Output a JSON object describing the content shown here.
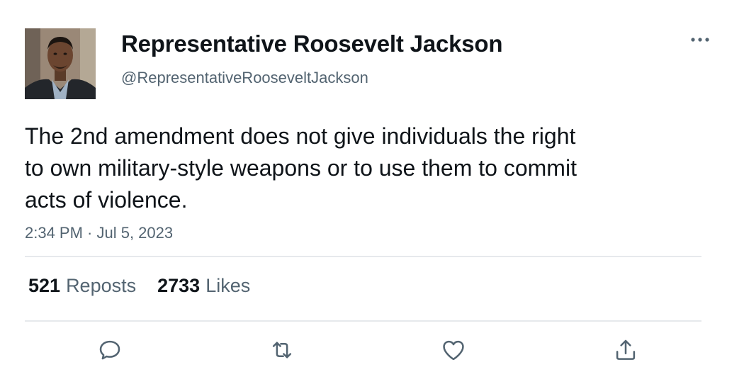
{
  "author": {
    "display_name": "Representative Roosevelt Jackson",
    "handle": "@RepresentativeRooseveltJackson",
    "avatar_icon": "profile-photo"
  },
  "tweet": {
    "text_lines": [
      "The 2nd amendment does not give individuals the right",
      "to own military-style weapons or to use them to commit",
      "acts of violence."
    ],
    "timestamp": "2:34 PM · Jul 5, 2023"
  },
  "stats": {
    "reposts_count": "521",
    "reposts_label": "Reposts",
    "likes_count": "2733",
    "likes_label": "Likes"
  },
  "actions": {
    "reply_icon": "reply-icon",
    "repost_icon": "repost-icon",
    "like_icon": "heart-icon",
    "share_icon": "share-icon"
  },
  "colors": {
    "text_primary": "#0f1419",
    "text_secondary": "#536471",
    "divider": "#e6e9ec"
  }
}
